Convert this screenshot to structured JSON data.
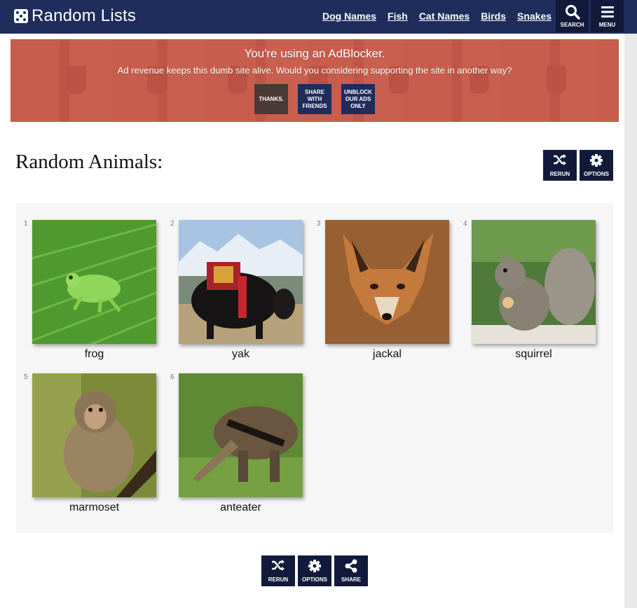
{
  "header": {
    "site_title": "Random Lists",
    "nav": [
      "Dog Names",
      "Fish",
      "Cat Names",
      "Birds",
      "Snakes"
    ],
    "search_label": "SEARCH",
    "menu_label": "MENU"
  },
  "ad_banner": {
    "title": "You're using an AdBlocker.",
    "subtitle": "Ad revenue keeps this dumb site alive. Would you considering supporting the site in another way?",
    "thanks_label": "THANKS.",
    "share_label": "SHARE WITH FRIENDS",
    "unblock_label": "UNBLOCK OUR ADS ONLY"
  },
  "page": {
    "title": "Random Animals:",
    "rerun_label": "RERUN",
    "options_label": "OPTIONS",
    "share_label": "SHARE"
  },
  "items": [
    {
      "num": "1",
      "name": "frog"
    },
    {
      "num": "2",
      "name": "yak"
    },
    {
      "num": "3",
      "name": "jackal"
    },
    {
      "num": "4",
      "name": "squirrel"
    },
    {
      "num": "5",
      "name": "marmoset"
    },
    {
      "num": "6",
      "name": "anteater"
    }
  ],
  "colors": {
    "header_bg": "#1e2d5c",
    "button_bg": "#111a3a",
    "banner_bg": "#c75b4a"
  }
}
